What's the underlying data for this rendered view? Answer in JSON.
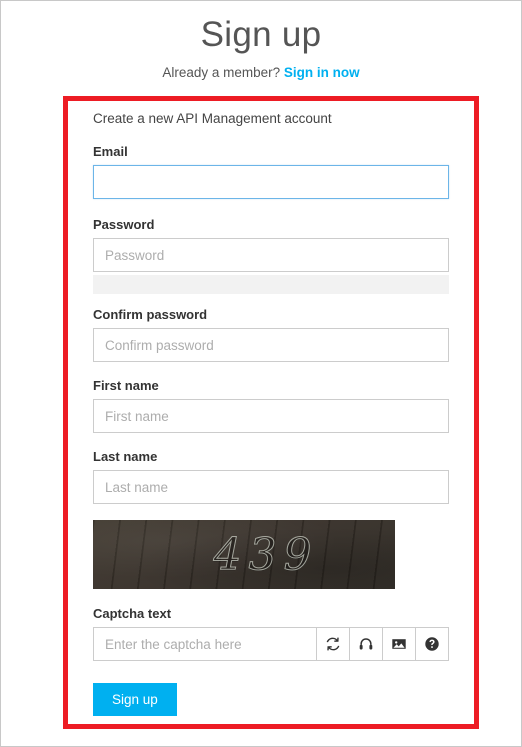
{
  "header": {
    "title": "Sign up",
    "member_prompt": "Already a member?",
    "signin_link": "Sign in now"
  },
  "form": {
    "caption": "Create a new API Management account",
    "fields": {
      "email": {
        "label": "Email",
        "value": "",
        "placeholder": "",
        "focused": true
      },
      "password": {
        "label": "Password",
        "value": "",
        "placeholder": "Password"
      },
      "confirm_password": {
        "label": "Confirm password",
        "value": "",
        "placeholder": "Confirm password"
      },
      "first_name": {
        "label": "First name",
        "value": "",
        "placeholder": "First name"
      },
      "last_name": {
        "label": "Last name",
        "value": "",
        "placeholder": "Last name"
      },
      "captcha": {
        "label": "Captcha text",
        "value": "",
        "placeholder": "Enter the captcha here",
        "image_code": "439"
      }
    },
    "captcha_buttons": [
      {
        "name": "refresh-icon",
        "title": "Refresh"
      },
      {
        "name": "headphones-icon",
        "title": "Audio"
      },
      {
        "name": "image-icon",
        "title": "Image"
      },
      {
        "name": "help-icon",
        "title": "Help"
      }
    ],
    "submit_label": "Sign up"
  },
  "colors": {
    "accent": "#00b0f0",
    "highlight_border": "#ed1c24",
    "field_border": "#cccccc",
    "focus_border": "#6cb5e8",
    "strength_bar": "#f2f2f2",
    "captcha_background": "#38312a"
  }
}
